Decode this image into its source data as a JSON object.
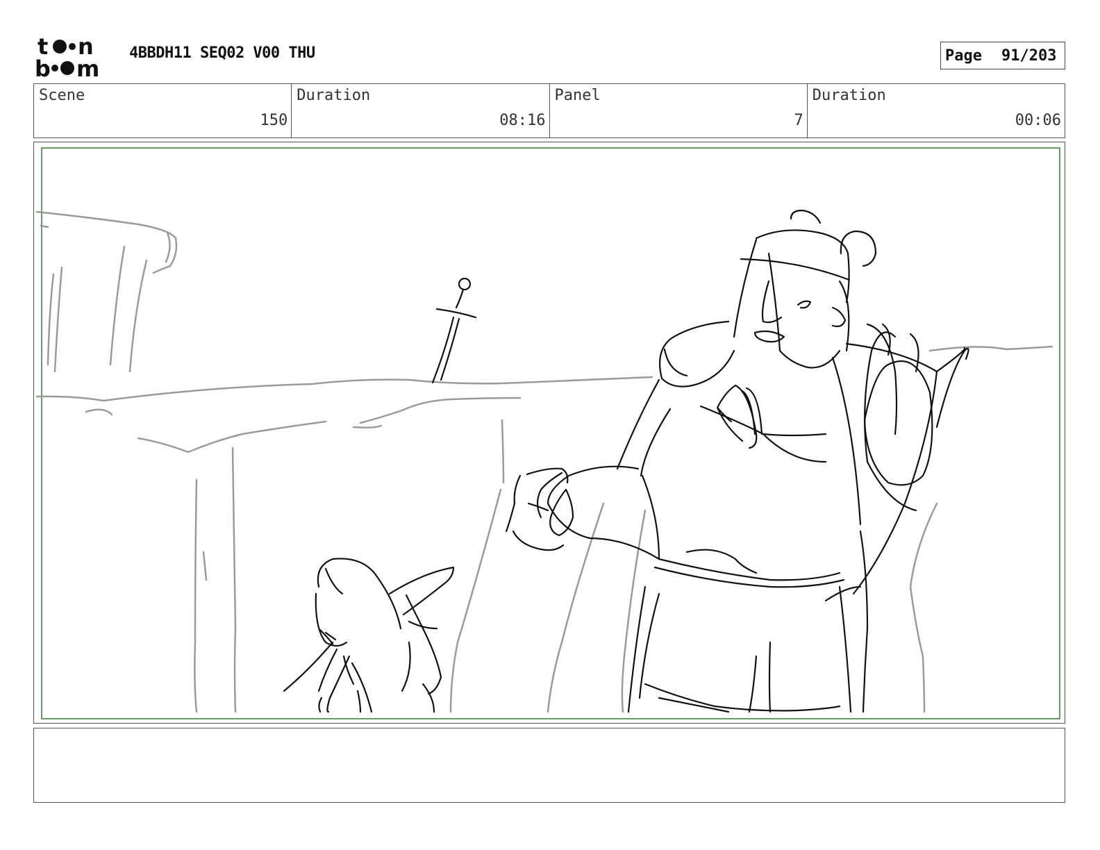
{
  "header": {
    "logo": {
      "top_word": "toon",
      "bottom_word": "boom"
    },
    "title": "4BBDH11 SEQ02 V00 THU",
    "page_label": "Page",
    "page_value": "91/203"
  },
  "info": {
    "scene_label": "Scene",
    "scene_value": "150",
    "scene_duration_label": "Duration",
    "scene_duration_value": "08:16",
    "panel_label": "Panel",
    "panel_value": "7",
    "panel_duration_label": "Duration",
    "panel_duration_value": "00:06"
  },
  "panel": {
    "safe_frame_color": "#2e7d32",
    "ink_color": "#111111",
    "rough_color": "#9a9a9a"
  },
  "caption": {
    "text": ""
  }
}
